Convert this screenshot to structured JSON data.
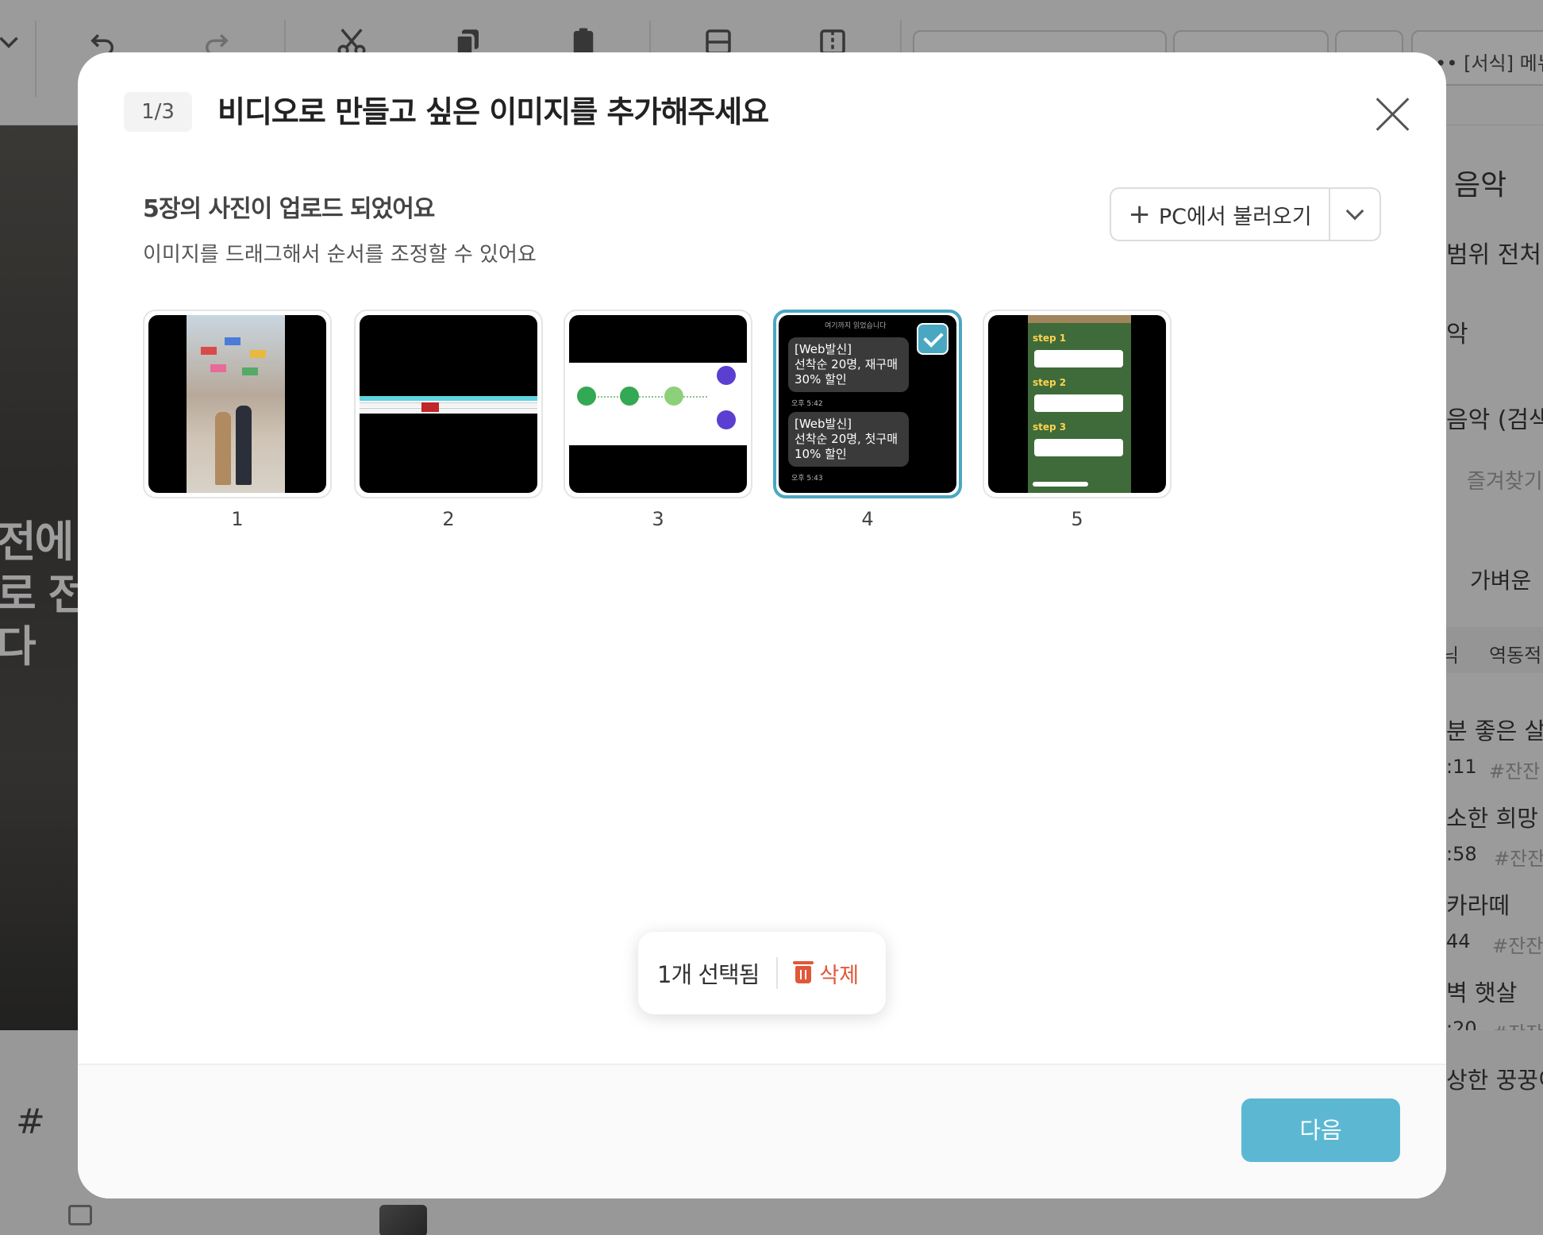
{
  "background": {
    "toolbar_menu_label": "[서식] 메뉴",
    "photo_caption": [
      "전에 !",
      "로 전",
      "다"
    ],
    "right_panel": {
      "title": "음악",
      "range_label": "범위  전처",
      "item_a": "악",
      "item_b": "음악 (검색",
      "favorites": "즐겨찾기",
      "search_value": "가벼운",
      "chip_a": "닉",
      "chip_b": "역동적",
      "songs": [
        {
          "title": "분 좋은 살링",
          "meta": ":11",
          "tag": "#잔잔"
        },
        {
          "title": "소한 희망",
          "meta": ":58",
          "tag": "#잔잔"
        },
        {
          "title": "카라떼",
          "meta": "44",
          "tag": "#잔잔"
        },
        {
          "title": "벽 햇살",
          "meta": ":20",
          "tag": "#잔잔"
        },
        {
          "title": "상한 꿍꿍이",
          "meta": "",
          "tag": ""
        }
      ]
    }
  },
  "modal": {
    "step": "1/3",
    "title": "비디오로 만들고 싶은 이미지를 추가해주세요",
    "upload_heading": "5장의 사진이 업로드 되었어요",
    "upload_sub": "이미지를 드래그해서 순서를 조정할 수 있어요",
    "import_button": "PC에서 불러오기",
    "thumbnails": [
      {
        "number": "1",
        "selected": false
      },
      {
        "number": "2",
        "selected": false
      },
      {
        "number": "3",
        "selected": false
      },
      {
        "number": "4",
        "selected": true
      },
      {
        "number": "5",
        "selected": false
      }
    ],
    "thumb4": {
      "top_note": "여기까지 읽었습니다",
      "msg1": "[Web발신]\n선착순 20명, 재구매\n30% 할인",
      "time1": "오후 5:42",
      "msg2": "[Web발신]\n선착순 20명, 첫구매\n10% 할인",
      "time2": "오후 5:43"
    },
    "thumb5": {
      "step1": "step 1",
      "step2": "step 2",
      "step3": "step 3"
    },
    "selection_count": "1개 선택됨",
    "delete_label": "삭제",
    "next_button": "다음",
    "accent_color": "#5cb8d2",
    "danger_color": "#e0583a"
  }
}
